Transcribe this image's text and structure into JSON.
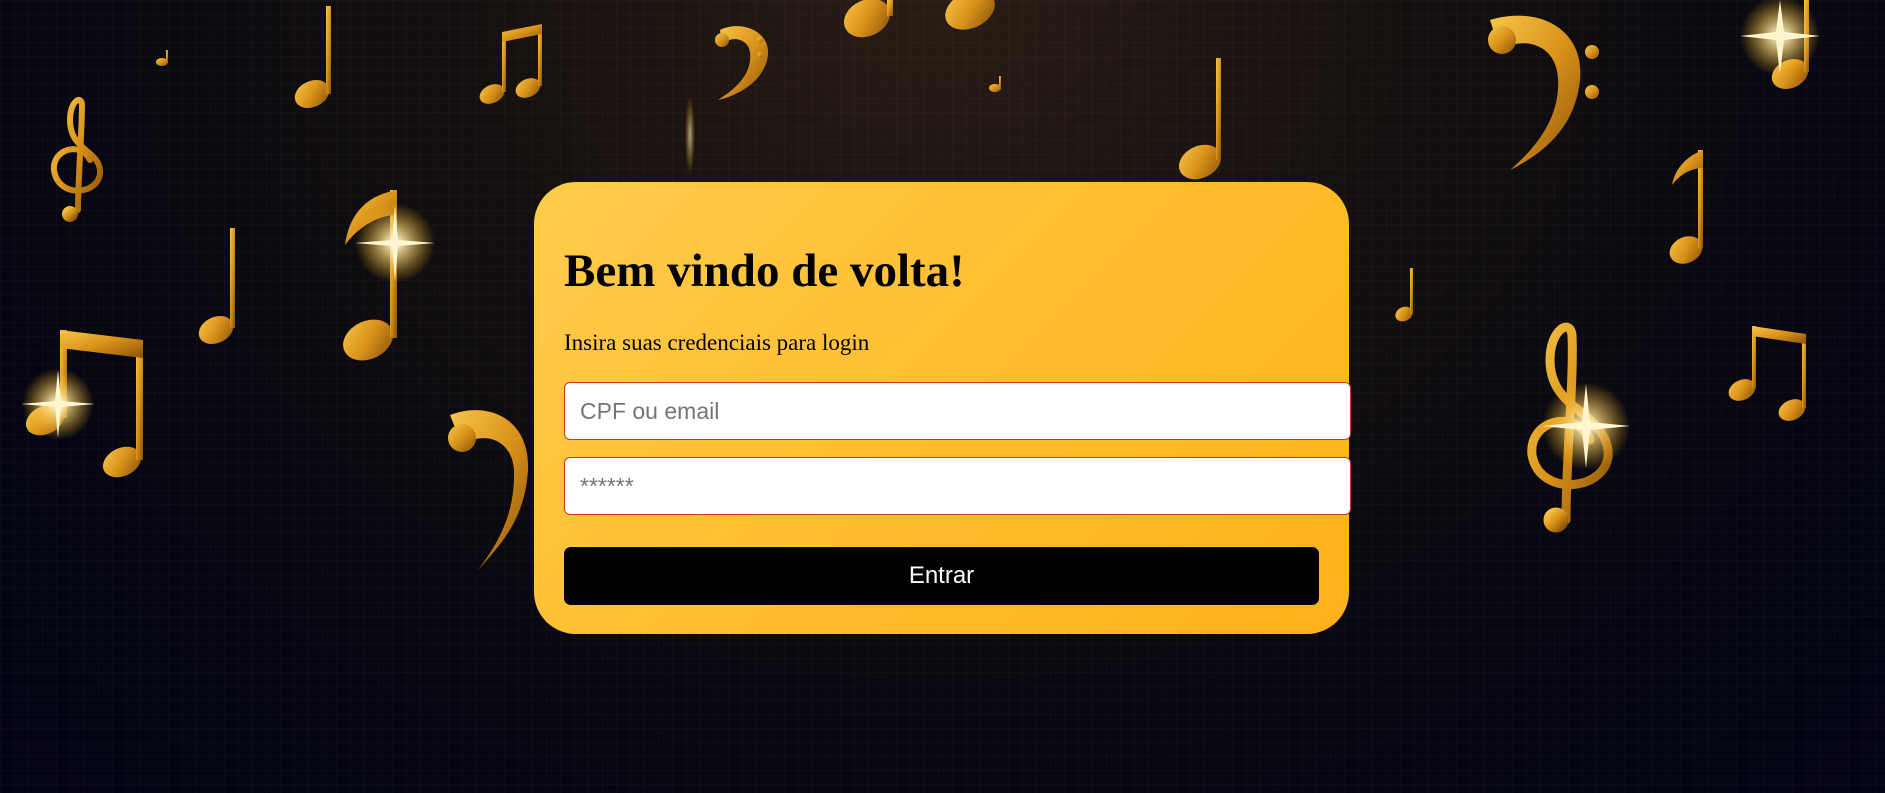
{
  "login": {
    "title": "Bem vindo de volta!",
    "subtitle": "Insira suas credenciais para login",
    "user_placeholder": "CPF ou email",
    "password_placeholder": "******",
    "submit_label": "Entrar"
  },
  "colors": {
    "card_gradient_start": "#ffcc4d",
    "card_gradient_end": "#ffb21a",
    "button_bg": "#000000",
    "button_text": "#ffffff",
    "input_border": "#c0392b",
    "background_dark": "#030414",
    "note_gold": "#e0a020"
  },
  "background": {
    "icons": [
      "music-note-icon",
      "beamed-notes-icon",
      "treble-clef-icon",
      "bass-clef-icon",
      "sparkle-icon"
    ]
  }
}
